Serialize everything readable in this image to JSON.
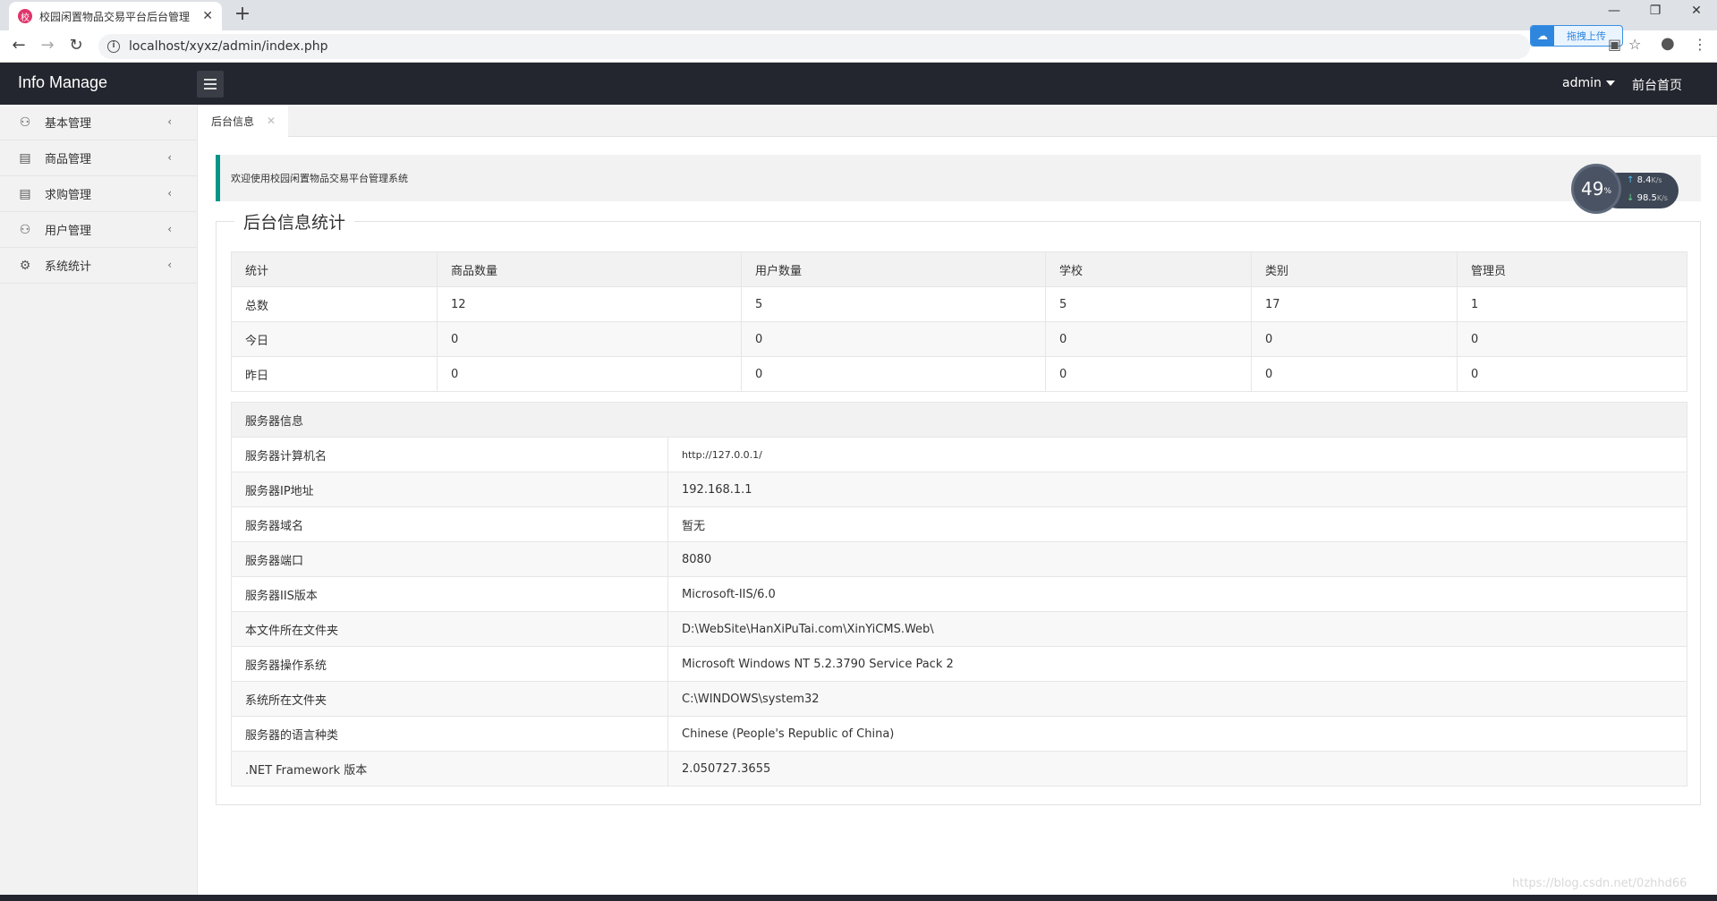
{
  "browser": {
    "tab_title": "校园闲置物品交易平台后台管理",
    "favicon_glyph": "校",
    "url": "localhost/xyxz/admin/index.php",
    "upload_label": "拖拽上传"
  },
  "header": {
    "logo": "Info Manage",
    "user": "admin",
    "front_link": "前台首页"
  },
  "sidebar": {
    "items": [
      {
        "label": "基本管理",
        "icon": "user-icon"
      },
      {
        "label": "商品管理",
        "icon": "document-icon"
      },
      {
        "label": "求购管理",
        "icon": "document-icon"
      },
      {
        "label": "用户管理",
        "icon": "user-icon"
      },
      {
        "label": "系统统计",
        "icon": "gear-icon"
      }
    ]
  },
  "content_tab": "后台信息",
  "welcome": "欢迎使用校园闲置物品交易平台管理系统",
  "stats": {
    "legend": "后台信息统计",
    "headers": [
      "统计",
      "商品数量",
      "用户数量",
      "学校",
      "类别",
      "管理员"
    ],
    "rows": [
      [
        "总数",
        "12",
        "5",
        "5",
        "17",
        "1"
      ],
      [
        "今日",
        "0",
        "0",
        "0",
        "0",
        "0"
      ],
      [
        "昨日",
        "0",
        "0",
        "0",
        "0",
        "0"
      ]
    ]
  },
  "server": {
    "title": "服务器信息",
    "rows": [
      [
        "服务器计算机名",
        "http://127.0.0.1/"
      ],
      [
        "服务器IP地址",
        "192.168.1.1"
      ],
      [
        "服务器域名",
        "暂无"
      ],
      [
        "服务器端口",
        "8080"
      ],
      [
        "服务器IIS版本",
        "Microsoft-IIS/6.0"
      ],
      [
        "本文件所在文件夹",
        "D:\\WebSite\\HanXiPuTai.com\\XinYiCMS.Web\\"
      ],
      [
        "服务器操作系统",
        "Microsoft Windows NT 5.2.3790 Service Pack 2"
      ],
      [
        "系统所在文件夹",
        "C:\\WINDOWS\\system32"
      ],
      [
        "服务器的语言种类",
        "Chinese (People's Republic of China)"
      ],
      [
        ".NET Framework 版本",
        "2.050727.3655"
      ]
    ]
  },
  "gauge": {
    "percent": "49",
    "percent_unit": "%",
    "up": "8.4",
    "down": "98.5",
    "unit": "K/s"
  },
  "watermark": "https://blog.csdn.net/0zhhd66"
}
